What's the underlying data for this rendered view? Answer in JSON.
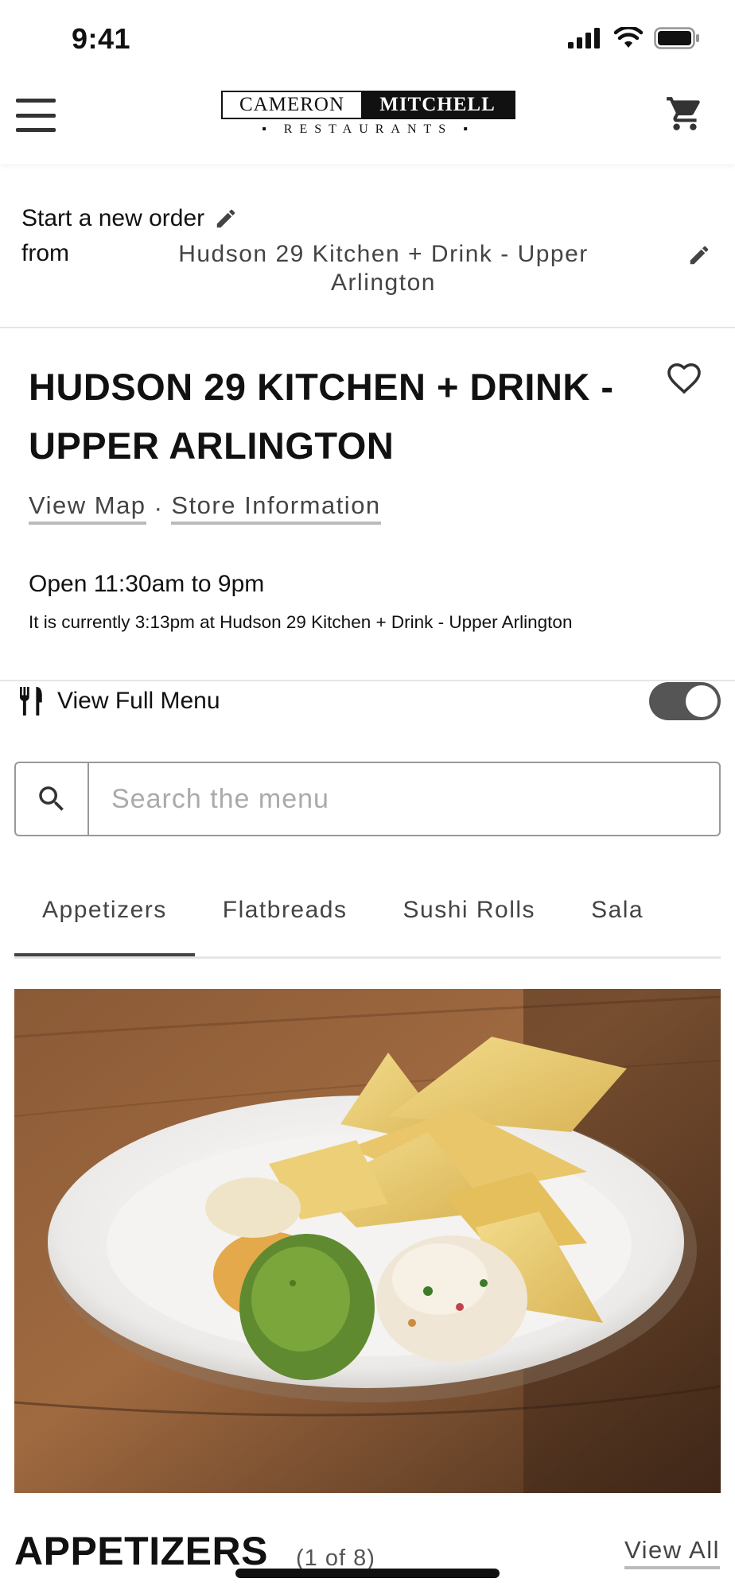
{
  "status_bar": {
    "time": "9:41"
  },
  "header": {
    "logo_cameron": "CAMERON",
    "logo_mitchell": "MITCHELL",
    "logo_restaurants": "▪ RESTAURANTS ▪",
    "icons": [
      "menu-icon",
      "cart-icon"
    ]
  },
  "order": {
    "start_label": "Start a new order",
    "from_label": "from",
    "location": "Hudson 29 Kitchen + Drink - Upper Arlington"
  },
  "restaurant": {
    "title": "HUDSON 29 KITCHEN + DRINK - UPPER ARLINGTON",
    "view_map": "View Map",
    "separator": "·",
    "store_information": "Store Information",
    "hours": "Open 11:30am to 9pm",
    "current_time_note": "It is currently 3:13pm at Hudson 29 Kitchen + Drink - Upper Arlington"
  },
  "menu_toggle": {
    "label": "View Full Menu",
    "enabled": true
  },
  "search": {
    "placeholder": "Search the menu",
    "value": ""
  },
  "tabs": [
    {
      "label": "Appetizers",
      "active": true
    },
    {
      "label": "Flatbreads",
      "active": false
    },
    {
      "label": "Sushi Rolls",
      "active": false
    },
    {
      "label": "Sala",
      "active": false
    }
  ],
  "section": {
    "title": "APPETIZERS",
    "count": "(1 of 8)",
    "view_all": "View All"
  },
  "colors": {
    "text_dark": "#111111",
    "text_muted": "#444444",
    "toggle_on": "#555555",
    "divider": "#e5e5e5"
  }
}
